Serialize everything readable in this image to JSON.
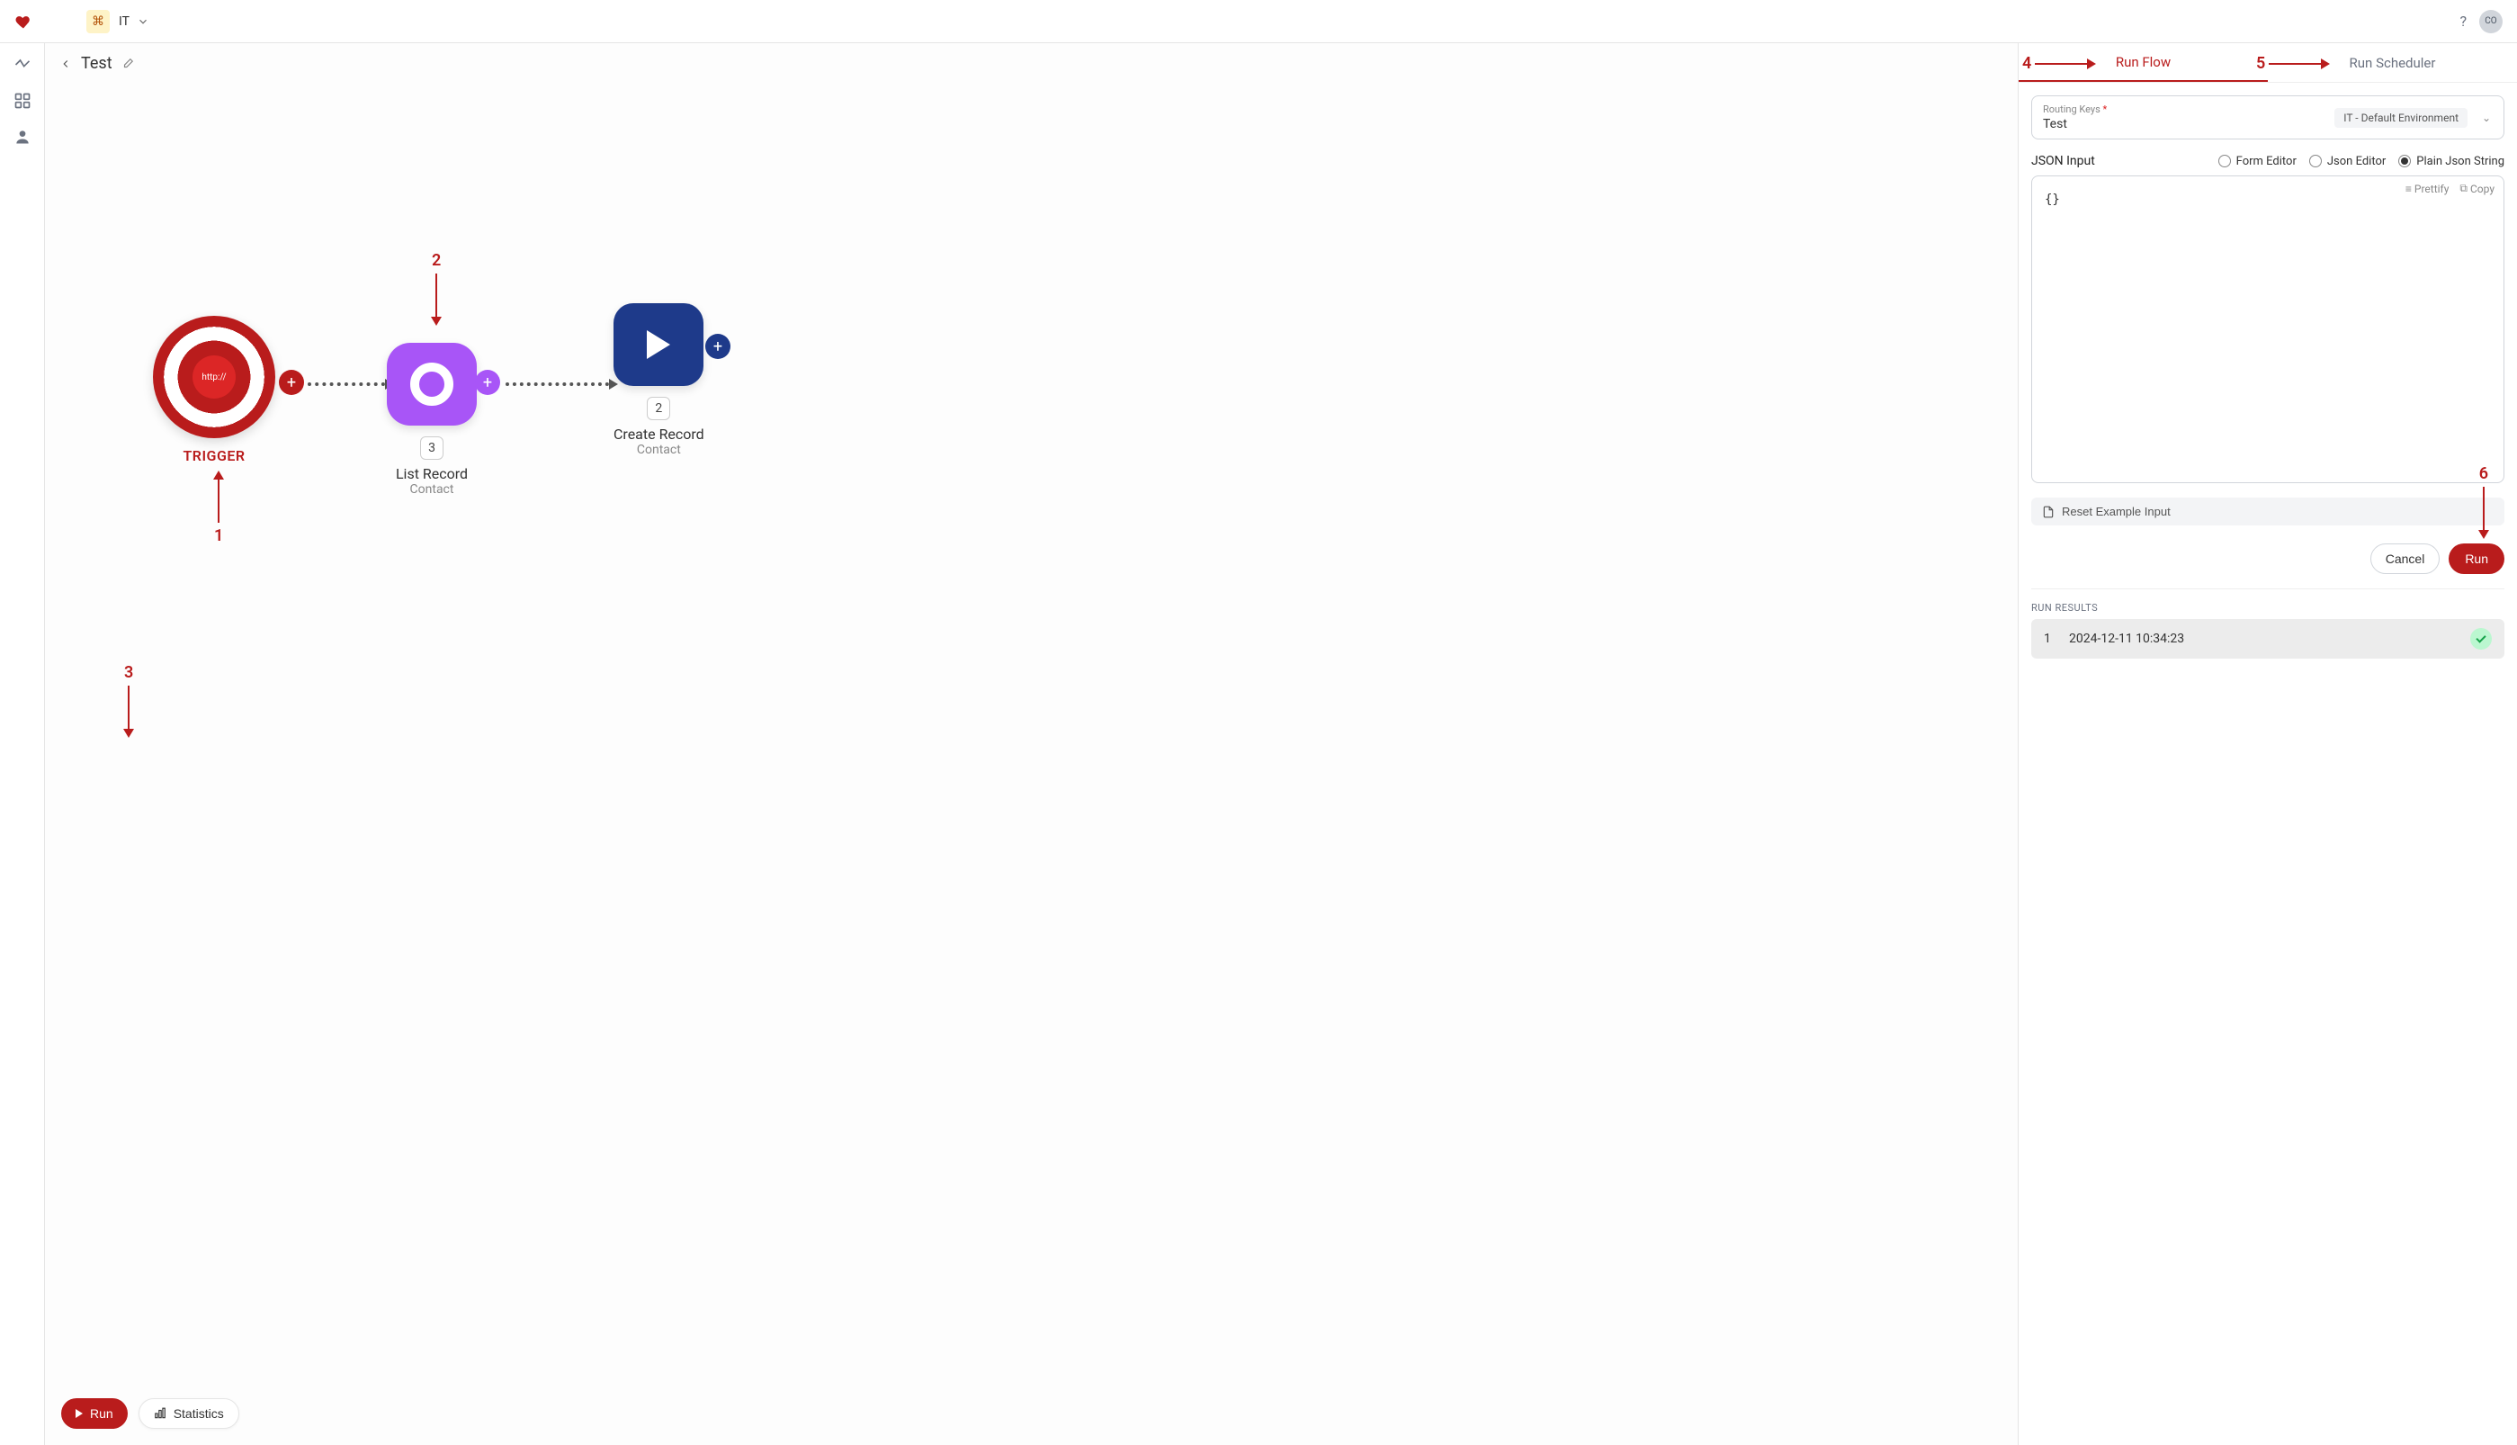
{
  "topbar": {
    "workspace": "IT",
    "avatar_initials": "CO"
  },
  "flow": {
    "name": "Test"
  },
  "nodes": {
    "trigger": {
      "label": "TRIGGER",
      "inner_text": "http://"
    },
    "list": {
      "badge": "3",
      "title": "List Record",
      "subtitle": "Contact"
    },
    "create": {
      "badge": "2",
      "title": "Create Record",
      "subtitle": "Contact"
    }
  },
  "canvas_footer": {
    "run": "Run",
    "stats": "Statistics"
  },
  "panel": {
    "tabs": {
      "run_flow": "Run Flow",
      "run_scheduler": "Run Scheduler"
    },
    "routing_label": "Routing Keys",
    "routing_value": "Test",
    "env_tag": "IT - Default Environment",
    "json_label": "JSON Input",
    "editors": {
      "form": "Form Editor",
      "json": "Json Editor",
      "plain": "Plain Json String"
    },
    "json_tools": {
      "prettify": "Prettify",
      "copy": "Copy"
    },
    "json_content": "{}",
    "reset": "Reset Example Input",
    "cancel": "Cancel",
    "run": "Run",
    "results_label": "RUN RESULTS",
    "result": {
      "index": "1",
      "timestamp": "2024-12-11 10:34:23"
    }
  },
  "annotations": {
    "a1": "1",
    "a2": "2",
    "a3": "3",
    "a4": "4",
    "a5": "5",
    "a6": "6"
  }
}
